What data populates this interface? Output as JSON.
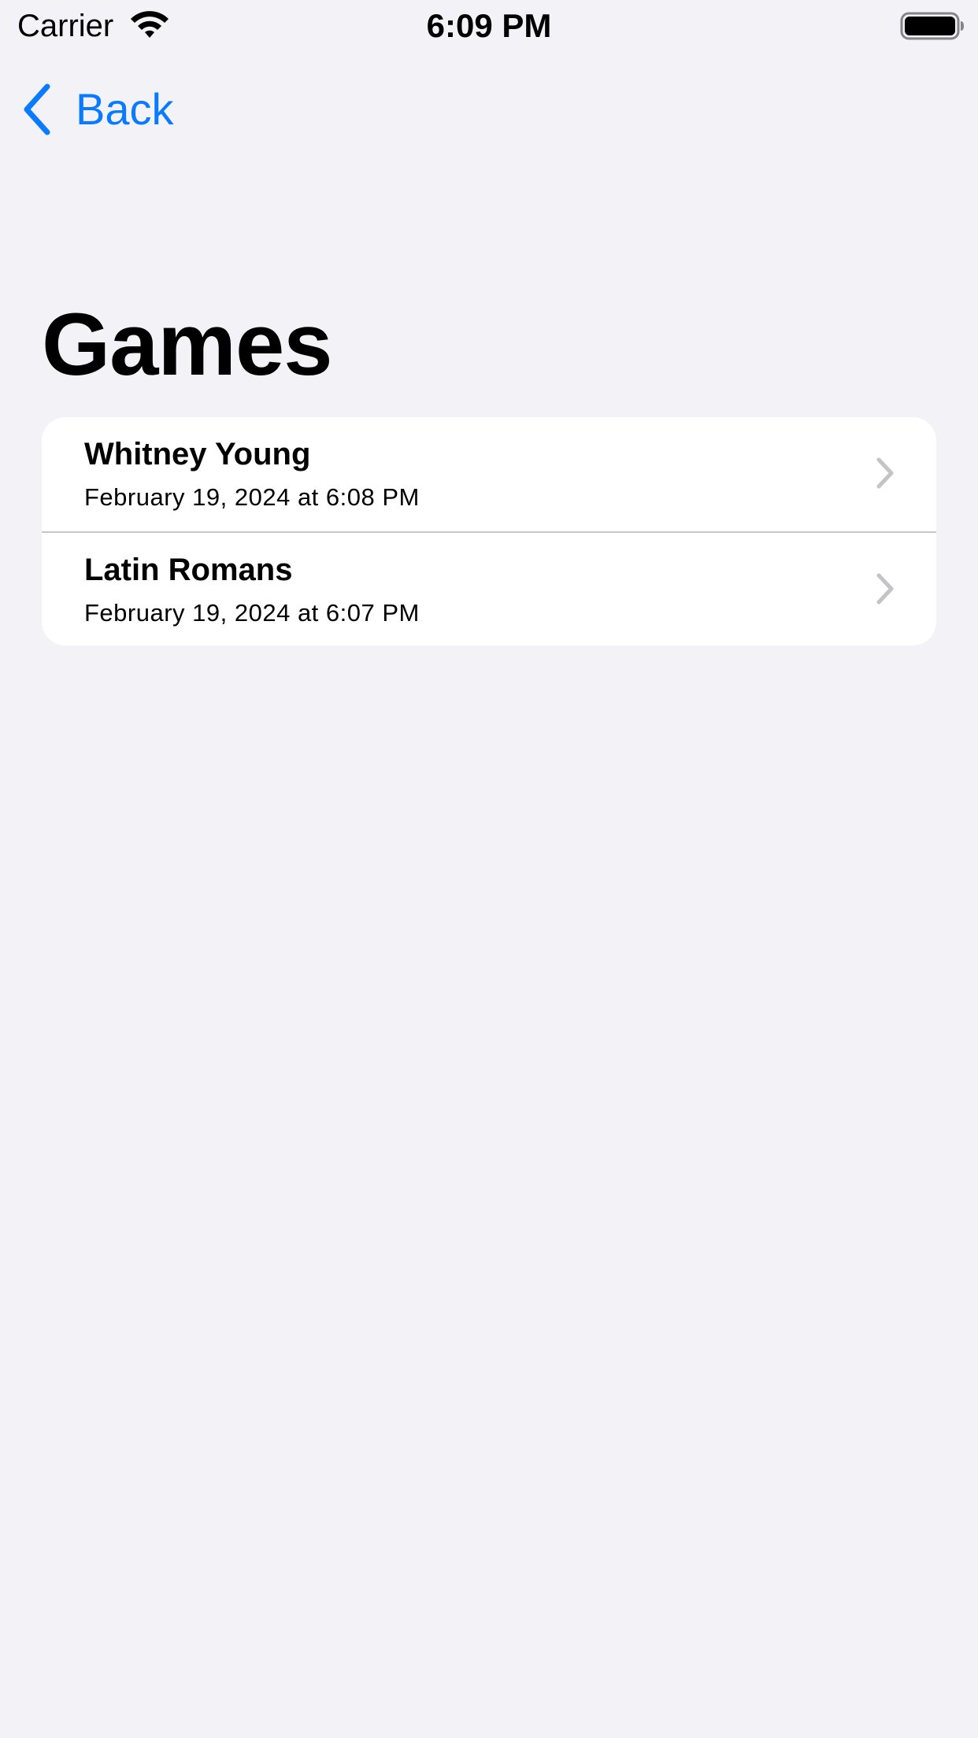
{
  "status_bar": {
    "carrier": "Carrier",
    "time": "6:09 PM",
    "wifi_icon": "wifi-icon",
    "battery_icon": "battery-full-icon"
  },
  "nav": {
    "back_label": "Back",
    "back_icon": "chevron-left-icon"
  },
  "page": {
    "title": "Games"
  },
  "games": [
    {
      "title": "Whitney Young",
      "date": "February 19, 2024 at 6:08 PM"
    },
    {
      "title": "Latin Romans",
      "date": "February 19, 2024 at 6:07 PM"
    }
  ],
  "colors": {
    "accent": "#0a7aff",
    "background": "#f2f2f7",
    "card": "#ffffff",
    "separator": "#c6c6c8",
    "chevron": "#c4c4c7"
  }
}
